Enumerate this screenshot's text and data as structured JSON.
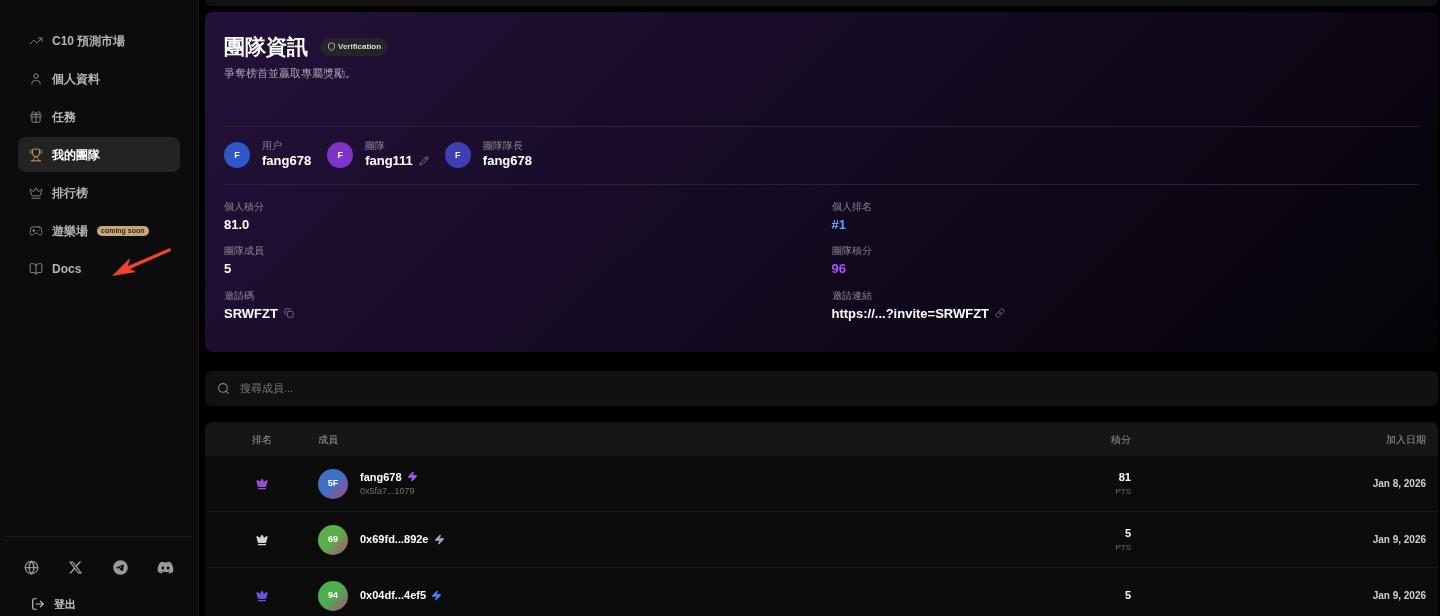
{
  "sidebar": {
    "items": [
      {
        "label": "C10 預測市場",
        "selected": false
      },
      {
        "label": "個人資料",
        "selected": false
      },
      {
        "label": "任務",
        "selected": false
      },
      {
        "label": "我的團隊",
        "selected": true
      },
      {
        "label": "排行榜",
        "selected": false
      },
      {
        "label": "遊樂場",
        "selected": false,
        "badge": "coming soon"
      },
      {
        "label": "Docs",
        "selected": false
      }
    ],
    "logout": "登出"
  },
  "team": {
    "title": "團隊資訊",
    "badge": "Verification",
    "subtitle": "爭奪榜首並贏取專屬獎勵。",
    "people": [
      {
        "avatar": "F",
        "label": "用户",
        "name": "fang678",
        "color": "#2f57c8",
        "editable": false
      },
      {
        "avatar": "F",
        "label": "團隊",
        "name": "fang111",
        "color": "#7e33c9",
        "editable": true
      },
      {
        "avatar": "F",
        "label": "團隊隊長",
        "name": "fang678",
        "color": "#3f3fb5",
        "editable": false
      }
    ],
    "stats": [
      {
        "label": "個人積分",
        "value": "81.0",
        "color": "#ffffff",
        "kind": "plain"
      },
      {
        "label": "個人排名",
        "value": "#1",
        "color": "#60a5fa",
        "kind": "plain"
      },
      {
        "label": "團隊成員",
        "value": "5",
        "color": "#ffffff",
        "kind": "plain"
      },
      {
        "label": "團隊積分",
        "value": "96",
        "color": "#a855f7",
        "kind": "plain"
      },
      {
        "label": "邀請碼",
        "value": "SRWFZT",
        "color": "#ffffff",
        "kind": "copy"
      },
      {
        "label": "邀請連結",
        "value": "https://...?invite=SRWFZT",
        "color": "#ffffff",
        "kind": "link"
      }
    ]
  },
  "search": {
    "placeholder": "搜尋成員..."
  },
  "table": {
    "columns": [
      "排名",
      "成員",
      "積分",
      "加入日期"
    ],
    "rows": [
      {
        "rank": {
          "color": "#9b4ddb"
        },
        "avatar": {
          "text": "5F",
          "color": "#3d6fc4"
        },
        "name": "fang678",
        "address": "0x5fa7...1079",
        "bolt": {
          "color": "#a855f7"
        },
        "points": "81",
        "unit": "PTS",
        "joined": "Jan 8, 2026"
      },
      {
        "rank": {
          "color": "#d4d4d4"
        },
        "avatar": {
          "text": "69",
          "color": "#5cae4a"
        },
        "name": "0x69fd...892e",
        "bolt": {
          "color": "#9ca3af"
        },
        "points": "5",
        "unit": "PTS",
        "joined": "Jan 9, 2026"
      },
      {
        "rank": {
          "color": "#6d4fe0"
        },
        "avatar": {
          "text": "94",
          "color": "#4caf50"
        },
        "name": "0x04df...4ef5",
        "bolt": {
          "color": "#3b82f6"
        },
        "points": "5",
        "joined": "Jan 9, 2026"
      }
    ]
  }
}
